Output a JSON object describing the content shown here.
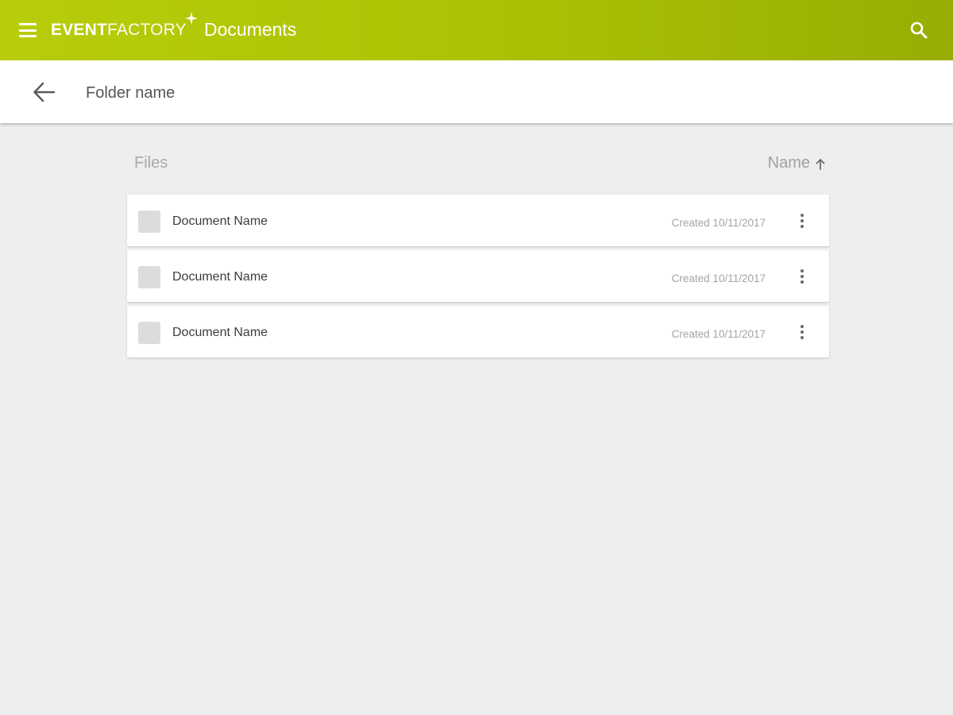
{
  "app_bar": {
    "brand_bold": "EVENT",
    "brand_light": "FACTORY",
    "title": "Documents",
    "background_gradient": [
      "#b8cc0a",
      "#97ad04"
    ],
    "menu_icon": "hamburger-menu-icon",
    "search_icon": "search-icon"
  },
  "subheader": {
    "back_icon": "arrow-left-icon",
    "folder_name": "Folder name"
  },
  "list_header": {
    "files_label": "Files",
    "sort_label": "Name",
    "sort_direction": "ascending",
    "sort_icon": "arrow-up-icon"
  },
  "files": [
    {
      "name": "Document Name",
      "created": "Created 10/11/2017",
      "more_icon": "more-vertical-icon"
    },
    {
      "name": "Document Name",
      "created": "Created 10/11/2017",
      "more_icon": "more-vertical-icon"
    },
    {
      "name": "Document Name",
      "created": "Created 10/11/2017",
      "more_icon": "more-vertical-icon"
    }
  ]
}
